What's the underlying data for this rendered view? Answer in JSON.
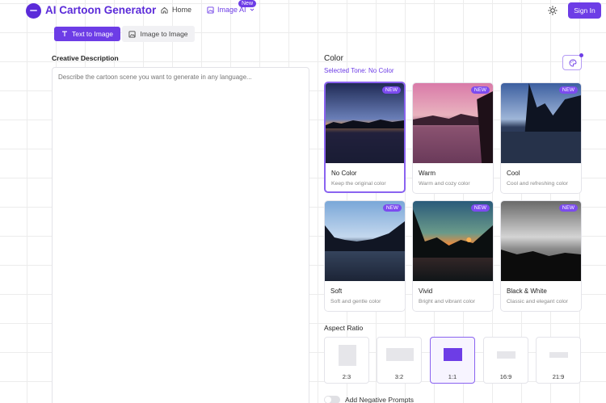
{
  "header": {
    "brand": "AI Cartoon Generator",
    "nav": [
      {
        "label": "Home",
        "icon": "home-icon"
      },
      {
        "label": "Image AI",
        "icon": "image-icon",
        "badge": "New"
      }
    ],
    "signin_label": "Sign In"
  },
  "tabs": [
    {
      "label": "Text to Image",
      "active": true
    },
    {
      "label": "Image to Image",
      "active": false
    }
  ],
  "left": {
    "description_label": "Creative Description",
    "description_placeholder": "Describe the cartoon scene you want to generate in any language..."
  },
  "color": {
    "title": "Color",
    "selected_tone": "Selected Tone: No Color",
    "options": [
      {
        "name": "No Color",
        "desc": "Keep the original color",
        "badge": "NEW",
        "selected": true
      },
      {
        "name": "Warm",
        "desc": "Warm and cozy color",
        "badge": "NEW",
        "selected": false
      },
      {
        "name": "Cool",
        "desc": "Cool and refreshing color",
        "badge": "NEW",
        "selected": false
      },
      {
        "name": "Soft",
        "desc": "Soft and gentle color",
        "badge": "NEW",
        "selected": false
      },
      {
        "name": "Vivid",
        "desc": "Bright and vibrant color",
        "badge": "NEW",
        "selected": false
      },
      {
        "name": "Black & White",
        "desc": "Classic and elegant color",
        "badge": "NEW",
        "selected": false
      }
    ]
  },
  "aspect_ratio": {
    "label": "Aspect Ratio",
    "options": [
      {
        "label": "2:3",
        "selected": false
      },
      {
        "label": "3:2",
        "selected": false
      },
      {
        "label": "1:1",
        "selected": true
      },
      {
        "label": "16:9",
        "selected": false
      },
      {
        "label": "21:9",
        "selected": false
      }
    ]
  },
  "negative_prompts_label": "Add Negative Prompts",
  "accent_color": "#6d3de6"
}
